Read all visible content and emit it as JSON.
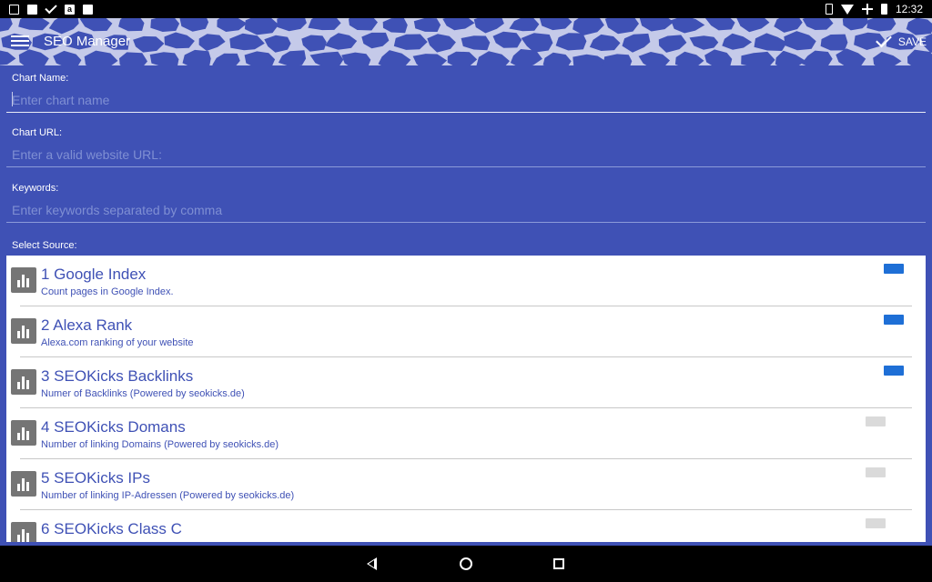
{
  "status_bar": {
    "time": "12:32",
    "left_icons": [
      "image-icon",
      "mail-icon",
      "check-icon",
      "amazon-icon",
      "briefcase-icon"
    ],
    "right_icons": [
      "vibrate-icon",
      "wifi-icon",
      "airplane-icon",
      "battery-icon"
    ]
  },
  "app_bar": {
    "title": "SEO Manager",
    "save_label": "SAVE",
    "colors": {
      "background": "#3f51b5",
      "pattern": "#c5cae9"
    }
  },
  "form": {
    "chart_name": {
      "label": "Chart Name:",
      "value": "",
      "placeholder": "Enter chart name"
    },
    "chart_url": {
      "label": "Chart URL:",
      "value": "",
      "placeholder": "Enter a valid website URL:"
    },
    "keywords": {
      "label": "Keywords:",
      "value": "",
      "placeholder": "Enter keywords separated by comma"
    },
    "select_source_label": "Select Source:"
  },
  "sources": [
    {
      "title": "1 Google Index",
      "description": "Count pages in Google Index.",
      "enabled": true
    },
    {
      "title": "2 Alexa Rank",
      "description": "Alexa.com ranking of your website",
      "enabled": true
    },
    {
      "title": "3 SEOKicks Backlinks",
      "description": "Numer of Backlinks (Powered by seokicks.de)",
      "enabled": true
    },
    {
      "title": "4 SEOKicks Domans",
      "description": "Number of linking Domains (Powered by seokicks.de)",
      "enabled": false
    },
    {
      "title": "5 SEOKicks IPs",
      "description": "Number of linking IP-Adressen (Powered by seokicks.de)",
      "enabled": false
    },
    {
      "title": "6 SEOKicks Class C",
      "description": "",
      "enabled": false
    }
  ],
  "colors": {
    "primary": "#3f51b5",
    "toggle_on": "#1e6fd6",
    "toggle_off": "#dadada"
  },
  "nav_bar": {
    "buttons": [
      "back-icon",
      "home-icon",
      "recent-apps-icon"
    ]
  }
}
